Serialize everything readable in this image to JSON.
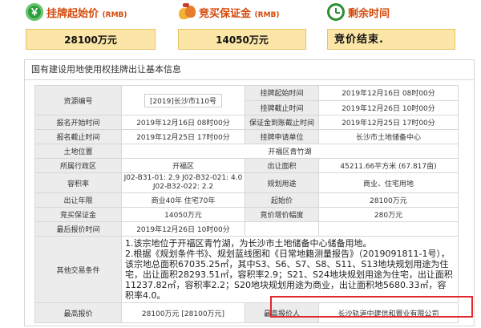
{
  "summary": {
    "start_price": {
      "title": "挂牌起始价",
      "unit": "(RMB)",
      "value": "28100万元"
    },
    "deposit": {
      "title": "竞买保证金",
      "unit": "(RMB)",
      "value": "14050万元"
    },
    "remaining": {
      "title": "剩余时间",
      "value": "竞价结束."
    }
  },
  "panel_title": "国有建设用地使用权挂牌出让基本信息",
  "labels": {
    "resource_no": "资源编号",
    "listing_start": "挂牌起始时间",
    "listing_end": "挂牌截止时间",
    "signup_start": "报名开始时间",
    "deposit_deadline": "保证金到账截止时间",
    "signup_end": "报名截止时间",
    "listing_unit": "挂牌申请单位",
    "location": "土地位置",
    "district": "所属行政区",
    "area": "出让面积",
    "plot_ratio": "容积率",
    "planned_use": "规划用途",
    "term": "出让年限",
    "start_price": "起始价",
    "deposit": "竞买保证金",
    "increment": "竞价增价幅度",
    "last_quote_time": "最后报价时间",
    "other": "其他交易条件",
    "highest_quote": "最高报价",
    "highest_bidder": "最高报价人"
  },
  "values": {
    "resource_no": "[2019]长沙市110号",
    "listing_start": "2019年12月16日 08时00分",
    "listing_end": "2019年12月26日 10时00分",
    "signup_start": "2019年12月16日 08时00分",
    "deposit_deadline": "2019年12月25日 17时00分",
    "signup_end": "2019年12月25日 17时00分",
    "listing_unit": "长沙市土地储备中心",
    "location": "开福区青竹湖",
    "district": "开福区",
    "area": "45211.66平方米 (67.817亩)",
    "plot_ratio": "J02-B31-01: 2.9 J02-B32-021: 4.0 J02-B32-022: 2.2",
    "planned_use": "商业、住宅用地",
    "term": "商业40年 住宅70年",
    "start_price": "28100万元",
    "deposit": "14050万元",
    "increment": "280万元",
    "last_quote_time": "2019年12月26日 10时00分",
    "other_line1": "1.该宗地位于开福区青竹湖，为长沙市土地储备中心储备用地。",
    "other_line2": "2.根据《规划条件书》、规划蓝线图和《日常地籍测量报告》（2019091811-1号），该宗地总面积67035.25㎡，其中S3、S6、S7、S8、S11、S13地块规划用途为住宅，出让面积28293.51㎡，容积率2.9；S21、S24地块规划用途为住宅，出让面积11237.82㎡，容积率2.2；S20地块规划用途为商业，出让面积地5680.33㎡，容积率4.0。",
    "highest_quote": "28100万元 [28100万元]",
    "highest_bidder": "长沙轨道中建信和置业有限公司"
  },
  "colors": {
    "accent": "#d4490a",
    "value_bg": "#fbe6a7",
    "label_bg": "#ececec",
    "highlight": "#e0282d"
  }
}
